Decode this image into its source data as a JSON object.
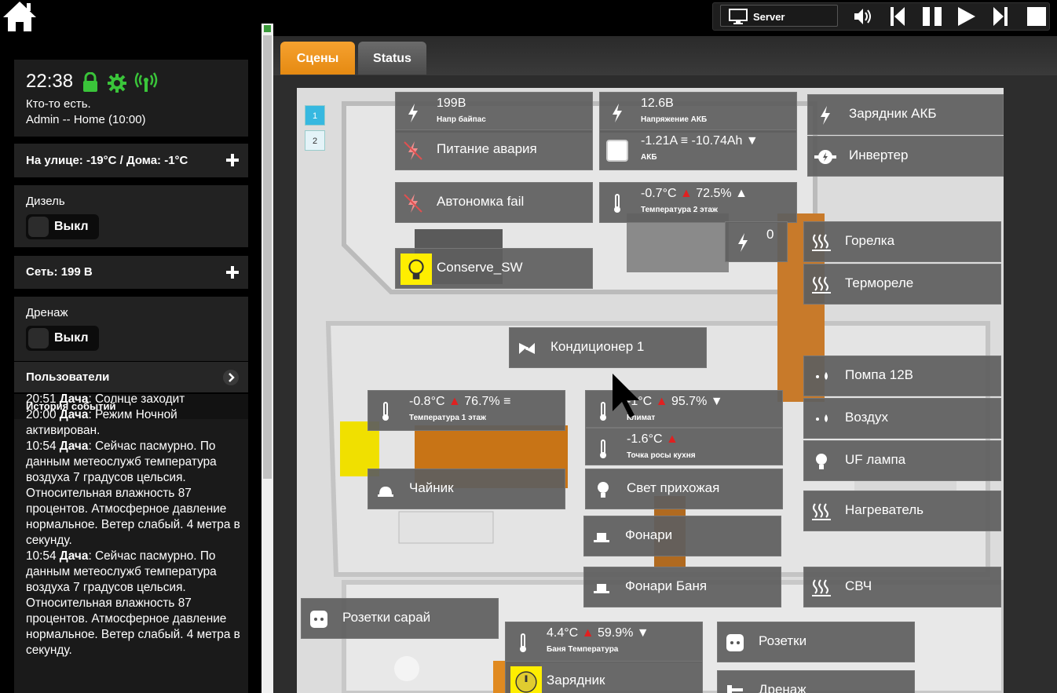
{
  "topbar": {
    "server_label": "Server",
    "icons": [
      "home-icon",
      "monitor-icon",
      "volume-icon",
      "skip-back-icon",
      "pause-icon",
      "play-icon",
      "skip-forward-icon",
      "stop-icon"
    ]
  },
  "sidebar": {
    "time": "22:38",
    "presence": "Кто-то есть.",
    "user_mode": "Admin -- Home (10:00)",
    "weather": "На улице: -19°C / Дома: -1°C",
    "diesel_label": "Дизель",
    "diesel_state": "Выкл",
    "grid": "Сеть: 199 В",
    "drain_label": "Дренаж",
    "drain_state": "Выкл",
    "users": "Пользователи",
    "history_title": "История событий",
    "history": [
      {
        "time": "20:51",
        "place": "Дача",
        "text": ": Солнце заходит"
      },
      {
        "time": "20:00",
        "place": "Дача",
        "text": ": Режим Ночной активирован."
      },
      {
        "time": "10:54",
        "place": "Дача",
        "text": ": Сейчас пасмурно. По данным метеослужб температура воздуха 7 градусов цельсия. Относительная влажность 87 процентов. Атмосферное давление нормальное. Ветер слабый. 4 метра в секунду."
      },
      {
        "time": "10:54",
        "place": "Дача",
        "text": ": Сейчас пасмурно. По данным метеослужб температура воздуха 7 градусов цельсия. Относительная влажность 87 процентов. Атмосферное давление нормальное. Ветер слабый. 4 метра в секунду."
      }
    ],
    "status_colors": {
      "lock": "#3ac43a",
      "gear": "#3ac43a",
      "signal": "#3ac43a"
    }
  },
  "tabs": [
    {
      "label": "Сцены",
      "active": true
    },
    {
      "label": "Status",
      "active": false
    }
  ],
  "pages": [
    "1",
    "2"
  ],
  "widgets": {
    "bypass_value": "199В",
    "bypass_sub": "Напр байпас",
    "battery_v_value": "12.6В",
    "battery_v_sub": "Напряжение АКБ",
    "charger_label": "Зарядник АКБ",
    "power_alarm": "Питание авария",
    "akb_value": "-1.21A ≡ -10.74Ah ▼",
    "akb_sub": "АКБ",
    "inverter": "Инвертер",
    "autonomy_fail": "Автономка fail",
    "temp2_value": "-0.7°C",
    "temp2_hum": "72.5%",
    "temp2_trend": "▲",
    "temp2_sub": "Температура 2 этаж",
    "power_zero": "0",
    "burner": "Горелка",
    "thermorelay": "Термореле",
    "conserve": "Conserve_SW",
    "ac": "Кондиционер 1",
    "pump": "Помпа 12В",
    "air": "Воздух",
    "temp1_value": "-0.8°C",
    "temp1_hum": "76.7% ≡",
    "temp1_sub": "Температура 1 этаж",
    "climate_value": "-1°C",
    "climate_hum": "95.7% ▼",
    "climate_sub": "Климат",
    "dew_value": "-1.6°C",
    "dew_sub": "Точка росы кухня",
    "uf_lamp": "UF лампа",
    "kettle": "Чайник",
    "hall_light": "Свет прихожая",
    "heater": "Нагреватель",
    "lanterns": "Фонари",
    "lanterns_bath": "Фонари Баня",
    "microwave": "СВЧ",
    "shed_sockets": "Розетки сарай",
    "bath_value": "4.4°C",
    "bath_hum": "59.9% ▼",
    "bath_sub": "Баня Температура",
    "sockets": "Розетки",
    "charger2": "Зарядник",
    "drain2": "Дренаж"
  },
  "colors": {
    "accent_tab": "#f19a24",
    "up_arrow": "#e02020",
    "highlight": "#ffee00"
  }
}
